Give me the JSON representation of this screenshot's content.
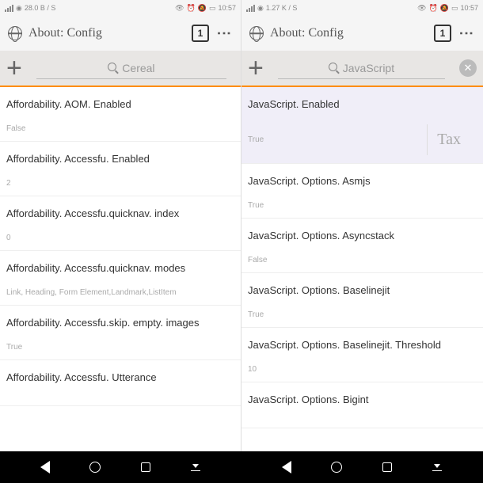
{
  "left": {
    "status": {
      "net": "28.0 B / S",
      "time": "10:57"
    },
    "title": "About: Config",
    "tabs": "1",
    "search": "Cereal",
    "rows": [
      {
        "k": "Affordability. AOM. Enabled",
        "v": "False"
      },
      {
        "k": "Affordability. Accessfu. Enabled",
        "v": "2"
      },
      {
        "k": "Affordability. Accessfu.quicknav. index",
        "v": "0"
      },
      {
        "k": "Affordability. Accessfu.quicknav. modes",
        "v": "Link, Heading, Form Element,Landmark,ListItem"
      },
      {
        "k": "Affordability. Accessfu.skip. empty. images",
        "v": "True"
      },
      {
        "k": "Affordability. Accessfu. Utterance",
        "v": ""
      }
    ]
  },
  "right": {
    "status": {
      "net": "1.27 K / S",
      "time": "10:57"
    },
    "title": "About: Config",
    "tabs": "1",
    "search": "JavaScript",
    "rows": [
      {
        "k": "JavaScript. Enabled",
        "v": "True",
        "hl": true,
        "tax": "Tax"
      },
      {
        "k": "JavaScript. Options. Asmjs",
        "v": "True"
      },
      {
        "k": "JavaScript. Options. Asyncstack",
        "v": "False"
      },
      {
        "k": "JavaScript. Options. Baselinejit",
        "v": "True"
      },
      {
        "k": "JavaScript. Options. Baselinejit. Threshold",
        "v": "10"
      },
      {
        "k": "JavaScript. Options. Bigint",
        "v": ""
      }
    ]
  }
}
